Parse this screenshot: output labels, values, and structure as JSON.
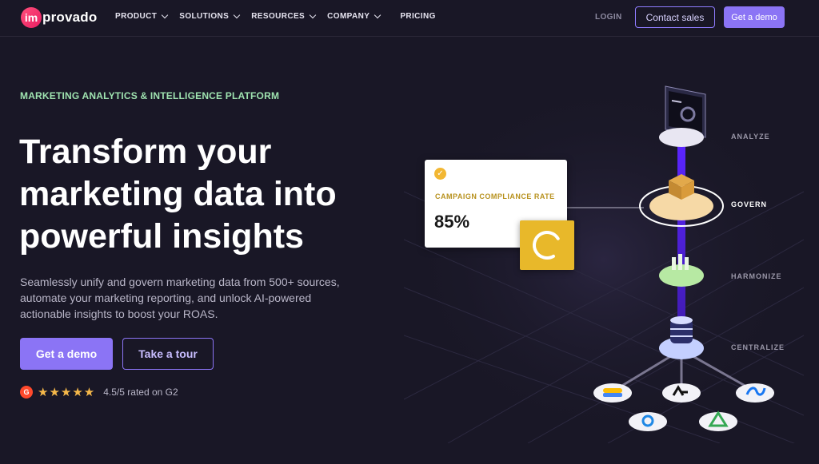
{
  "nav": {
    "logo_mark": "im",
    "logo_text": "provado",
    "menu": [
      {
        "label": "PRODUCT"
      },
      {
        "label": "SOLUTIONS"
      },
      {
        "label": "RESOURCES"
      },
      {
        "label": "COMPANY"
      }
    ],
    "pricing": "PRICING",
    "login": "LOGIN",
    "contact_sales": "Contact sales",
    "get_demo": "Get a demo"
  },
  "hero": {
    "eyebrow": "MARKETING ANALYTICS & INTELLIGENCE PLATFORM",
    "headline_line1": "Transform your",
    "headline_line2": "marketing data into",
    "headline_line3": "powerful insights",
    "subtext": "Seamlessly unify and govern marketing data from 500+ sources, automate your marketing reporting, and unlock AI-powered actionable insights to boost your ROAS.",
    "cta_demo": "Get a demo",
    "cta_tour": "Take a tour",
    "rating_badge": "G",
    "rating_stars": "★★★★★",
    "rating_text": "4.5/5 rated on G2"
  },
  "illustration": {
    "card_label": "CAMPAIGN COMPLIANCE RATE",
    "card_value": "85%",
    "stages": [
      {
        "label": "ANALYZE"
      },
      {
        "label": "GOVERN"
      },
      {
        "label": "HARMONIZE"
      },
      {
        "label": "CENTRALIZE"
      }
    ],
    "accent": "#8b74f5",
    "beam_color": "#6a2cff"
  }
}
